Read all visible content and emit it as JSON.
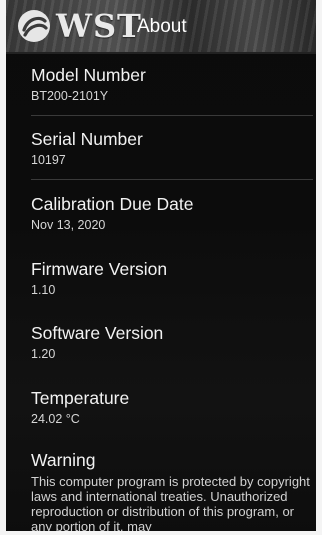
{
  "header": {
    "logo_text": "WST",
    "title": "About",
    "logo_icon": "wst-swirl-logo-icon"
  },
  "items": [
    {
      "label": "Model Number",
      "value": "BT200-2101Y"
    },
    {
      "label": "Serial Number",
      "value": "10197"
    },
    {
      "label": "Calibration Due Date",
      "value": "Nov 13, 2020"
    },
    {
      "label": "Firmware Version",
      "value": "1.10"
    },
    {
      "label": "Software Version",
      "value": "1.20"
    },
    {
      "label": "Temperature",
      "value": "24.02 °C"
    }
  ],
  "warning": {
    "label": "Warning",
    "text": "This computer program is protected by copyright laws and international treaties. Unauthorized reproduction or distribution of this program, or any portion of it, may"
  },
  "colors": {
    "background": "#0c0c0c",
    "text_primary": "#f2f2f2",
    "text_secondary": "#d6d6d6"
  }
}
